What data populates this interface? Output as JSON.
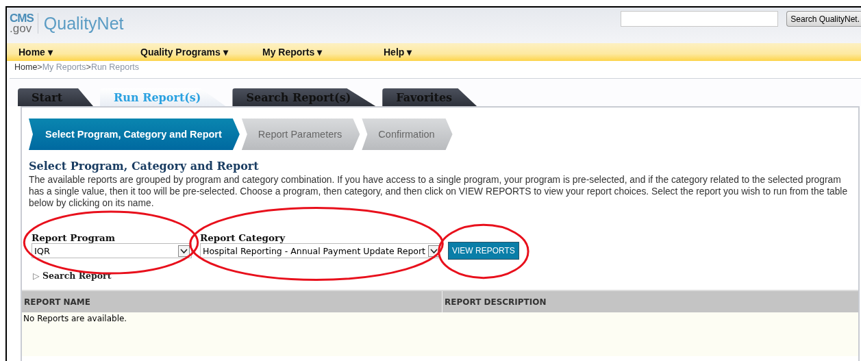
{
  "header": {
    "logo_top": "CMS",
    "logo_bottom": ".gov",
    "site_name": "QualityNet",
    "search_button": "Search QualityNet."
  },
  "nav": [
    {
      "label": "Home",
      "caret": "▾"
    },
    {
      "label": "Quality Programs",
      "caret": "▾"
    },
    {
      "label": "My Reports",
      "caret": "▾"
    },
    {
      "label": "Help",
      "caret": "▾"
    }
  ],
  "breadcrumb": [
    {
      "label": "Home",
      "current": false,
      "sep": ">"
    },
    {
      "label": "My Reports",
      "current": true,
      "sep": ">"
    },
    {
      "label": "Run Reports",
      "current": true
    }
  ],
  "tabs": [
    {
      "label": "Start",
      "selected": false
    },
    {
      "label": "Run Report(s)",
      "selected": true
    },
    {
      "label": "Search Report(s)",
      "selected": false
    },
    {
      "label": "Favorites",
      "selected": false
    }
  ],
  "steps": [
    {
      "label": "Select Program, Category and Report",
      "selected": true
    },
    {
      "label": "Report Parameters",
      "selected": false
    },
    {
      "label": "Confirmation",
      "selected": false
    }
  ],
  "section_title": "Select Program, Category and Report",
  "description": "The available reports are grouped by program and category combination. If you have access to a single program, your program is pre-selected, and if the category related to the selected program has a single value, then it too will be pre-selected. Choose a program, then category, and then click on VIEW REPORTS to view your report choices. Select the report you wish to run from the table below by clicking on its name.",
  "fields": [
    {
      "label": "Report Program",
      "value": "IQR",
      "circled": true
    },
    {
      "label": "Report Category",
      "value": "Hospital Reporting - Annual Payment Update Report",
      "circled": true
    }
  ],
  "view_button": {
    "label": "VIEW REPORTS",
    "circled": true
  },
  "search_report": {
    "icon": "▷",
    "label": "Search Report",
    "expanded": false
  },
  "table": {
    "columns": [
      "REPORT NAME",
      "REPORT DESCRIPTION"
    ],
    "empty_message": "No Reports are available."
  }
}
